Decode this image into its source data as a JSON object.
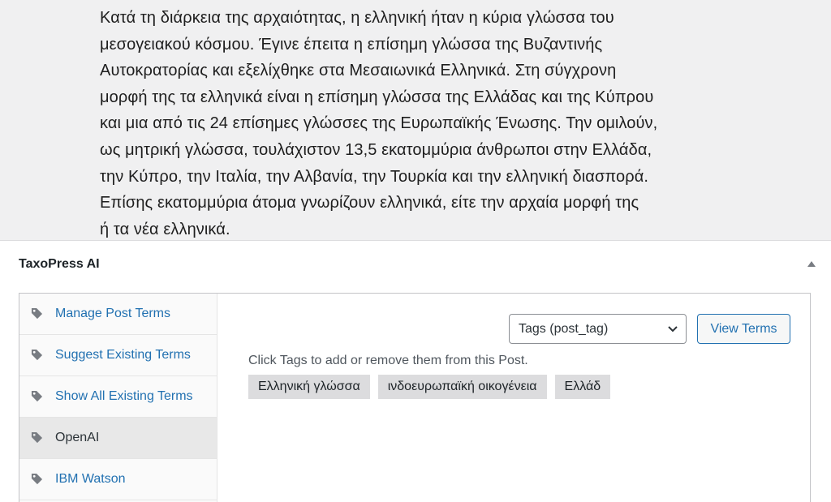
{
  "editor": {
    "paragraph": "Κατά τη διάρκεια της αρχαιότητας, η ελληνική ήταν η κύρια γλώσσα του\nμεσογειακού κόσμου. Έγινε έπειτα η επίσημη γλώσσα της Βυζαντινής\nΑυτοκρατορίας και εξελίχθηκε στα Μεσαιωνικά Ελληνικά. Στη σύγχρονη\nμορφή της τα ελληνικά είναι η επίσημη γλώσσα της Ελλάδας και της Κύπρου\nκαι μια από τις 24 επίσημες γλώσσες της Ευρωπαϊκής Ένωσης. Την ομιλούν,\nως μητρική γλώσσα, τουλάχιστον 13,5 εκατομμύρια άνθρωποι στην Ελλάδα,\nτην Κύπρο, την Ιταλία, την Αλβανία, την Τουρκία και την ελληνική διασπορά.\nΕπίσης εκατομμύρια άτομα γνωρίζουν ελληνικά, είτε την αρχαία μορφή της\nή τα νέα ελληνικά."
  },
  "metabox": {
    "title": "TaxoPress AI",
    "toggle_icon": "triangle-up-icon",
    "tabs": [
      {
        "label": "Manage Post Terms",
        "icon": "tag-icon",
        "active": false
      },
      {
        "label": "Suggest Existing Terms",
        "icon": "tag-icon",
        "active": false
      },
      {
        "label": "Show All Existing Terms",
        "icon": "tag-icon",
        "active": false
      },
      {
        "label": "OpenAI",
        "icon": "tag-icon",
        "active": true
      },
      {
        "label": "IBM Watson",
        "icon": "tag-icon",
        "active": false
      }
    ],
    "taxonomy_select": {
      "value": "Tags (post_tag)"
    },
    "view_terms_label": "View Terms",
    "hint": "Click Tags to add or remove them from this Post.",
    "terms": [
      "Ελληνική γλώσσα",
      "ινδοευρωπαϊκή οικογένεια",
      "Ελλάδ"
    ]
  },
  "colors": {
    "link": "#2271b1",
    "term_bg": "#dcdcde",
    "active_tab_bg": "#e8e8e8",
    "page_bg": "#f0f0f1"
  }
}
